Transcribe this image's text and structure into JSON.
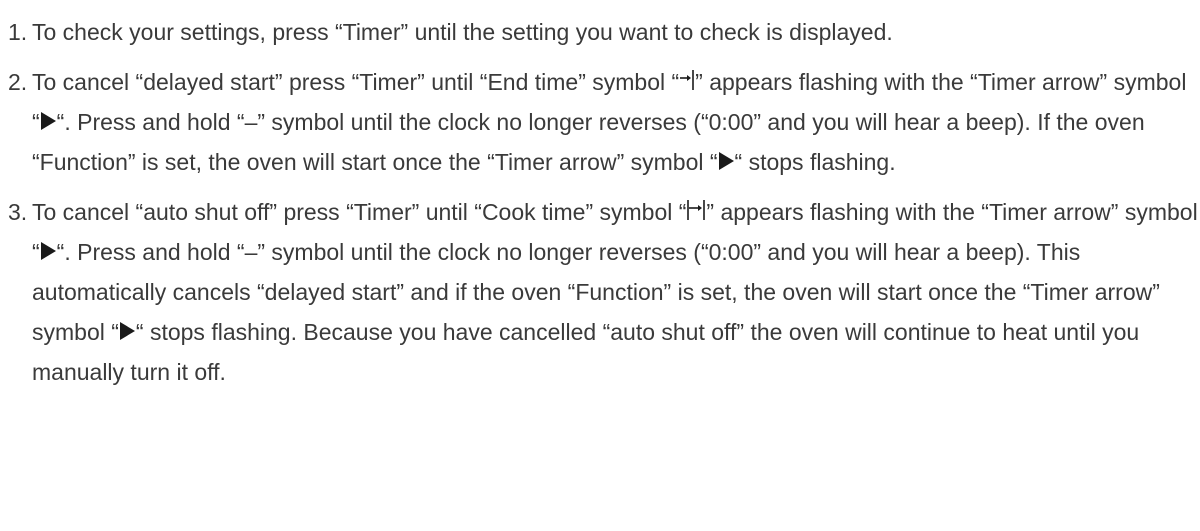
{
  "steps": [
    {
      "number": "1.",
      "parts": [
        {
          "type": "text",
          "value": "To check your settings, press “Timer” until the setting you want to check is displayed."
        }
      ]
    },
    {
      "number": "2.",
      "parts": [
        {
          "type": "text",
          "value": "To cancel “delayed start” press “Timer” until “End time” symbol “"
        },
        {
          "type": "icon",
          "icon": "end-time-icon"
        },
        {
          "type": "text",
          "value": "” appears flashing with the “Timer arrow” symbol “"
        },
        {
          "type": "icon",
          "icon": "timer-arrow-icon"
        },
        {
          "type": "text",
          "value": "“. Press and hold “–” symbol until the clock no longer reverses (“0:00” and you will hear a beep). If the oven “Function” is set, the oven will start once the “Timer arrow” symbol “"
        },
        {
          "type": "icon",
          "icon": "timer-arrow-icon"
        },
        {
          "type": "text",
          "value": "“ stops flashing."
        }
      ]
    },
    {
      "number": "3.",
      "parts": [
        {
          "type": "text",
          "value": "To cancel “auto shut off” press “Timer” until “Cook time” symbol “"
        },
        {
          "type": "icon",
          "icon": "cook-time-icon"
        },
        {
          "type": "text",
          "value": "” appears flashing with the “Timer arrow” symbol “"
        },
        {
          "type": "icon",
          "icon": "timer-arrow-icon"
        },
        {
          "type": "text",
          "value": "“. Press and hold “–” symbol until the clock no longer reverses (“0:00” and you will hear a beep). This automatically cancels “delayed start” and if the oven “Function” is set, the oven will start once the “Timer arrow” symbol “"
        },
        {
          "type": "icon",
          "icon": "timer-arrow-icon"
        },
        {
          "type": "text",
          "value": "“ stops flashing. Because you have cancelled “auto shut off” the oven will continue to heat until you manually turn it off."
        }
      ]
    }
  ],
  "colors": {
    "text": "#3a3a3a",
    "icon": "#1a1a1a",
    "background": "#ffffff"
  }
}
